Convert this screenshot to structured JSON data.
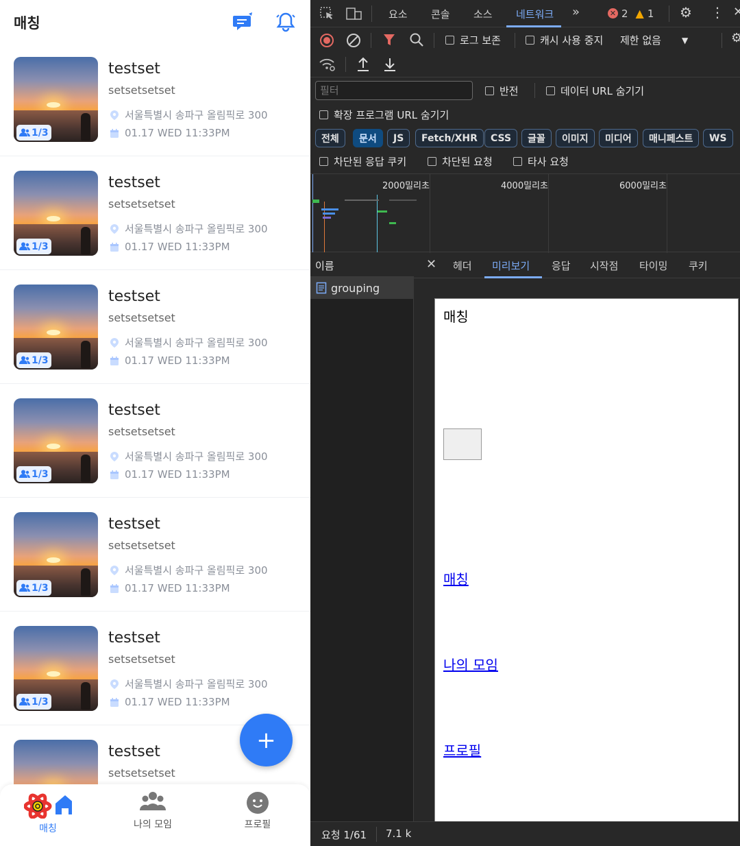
{
  "app": {
    "title": "매칭",
    "cards": [
      {
        "title": "testset",
        "subtitle": "setsetsetset",
        "location": "서울특별시 송파구 올림픽로 300",
        "datetime": "01.17 WED 11:33PM",
        "badge": "1/3"
      },
      {
        "title": "testset",
        "subtitle": "setsetsetset",
        "location": "서울특별시 송파구 올림픽로 300",
        "datetime": "01.17 WED 11:33PM",
        "badge": "1/3"
      },
      {
        "title": "testset",
        "subtitle": "setsetsetset",
        "location": "서울특별시 송파구 올림픽로 300",
        "datetime": "01.17 WED 11:33PM",
        "badge": "1/3"
      },
      {
        "title": "testset",
        "subtitle": "setsetsetset",
        "location": "서울특별시 송파구 올림픽로 300",
        "datetime": "01.17 WED 11:33PM",
        "badge": "1/3"
      },
      {
        "title": "testset",
        "subtitle": "setsetsetset",
        "location": "서울특별시 송파구 올림픽로 300",
        "datetime": "01.17 WED 11:33PM",
        "badge": "1/3"
      },
      {
        "title": "testset",
        "subtitle": "setsetsetset",
        "location": "서울특별시 송파구 올림픽로 300",
        "datetime": "01.17 WED 11:33PM",
        "badge": "1/3"
      },
      {
        "title": "testset",
        "subtitle": "setsetsetset",
        "location": "",
        "datetime": "",
        "badge": ""
      }
    ],
    "fab_label": "+",
    "nav": {
      "matching": "매칭",
      "my_groups": "나의 모임",
      "profile": "프로필"
    },
    "accent_color": "#2f7bf6"
  },
  "devtools": {
    "tabs": [
      "요소",
      "콘솔",
      "소스",
      "네트워크"
    ],
    "active_tab": "네트워크",
    "more_tabs": "»",
    "error_count": "2",
    "warning_count": "1",
    "toolbar": {
      "preserve_log": "로그 보존",
      "disable_cache": "캐시 사용 중지",
      "throttling": "제한 없음"
    },
    "filter": {
      "placeholder": "필터",
      "invert": "반전",
      "hide_data_urls": "데이터 URL 숨기기",
      "hide_extension_urls": "확장 프로그램 URL 숨기기"
    },
    "type_filters": [
      "전체",
      "문서",
      "JS",
      "Fetch/XHR",
      "CSS",
      "글꼴",
      "이미지",
      "미디어",
      "매니페스트",
      "WS"
    ],
    "active_type_filter": "문서",
    "blocked": {
      "blocked_cookies": "차단된 응답 쿠키",
      "blocked_requests": "차단된 요청",
      "third_party": "타사 요청"
    },
    "timeline_labels": [
      "2000밀리초",
      "4000밀리초",
      "6000밀리초"
    ],
    "name_column": "이름",
    "request_name": "grouping",
    "detail_tabs": [
      "헤더",
      "미리보기",
      "응답",
      "시작점",
      "타이밍",
      "쿠키"
    ],
    "active_detail_tab": "미리보기",
    "preview": {
      "title": "매칭",
      "links": [
        "매칭",
        "나의 모임",
        "프로필"
      ]
    },
    "status": {
      "requests": "요청 1/61",
      "transferred": "7.1 k"
    }
  }
}
